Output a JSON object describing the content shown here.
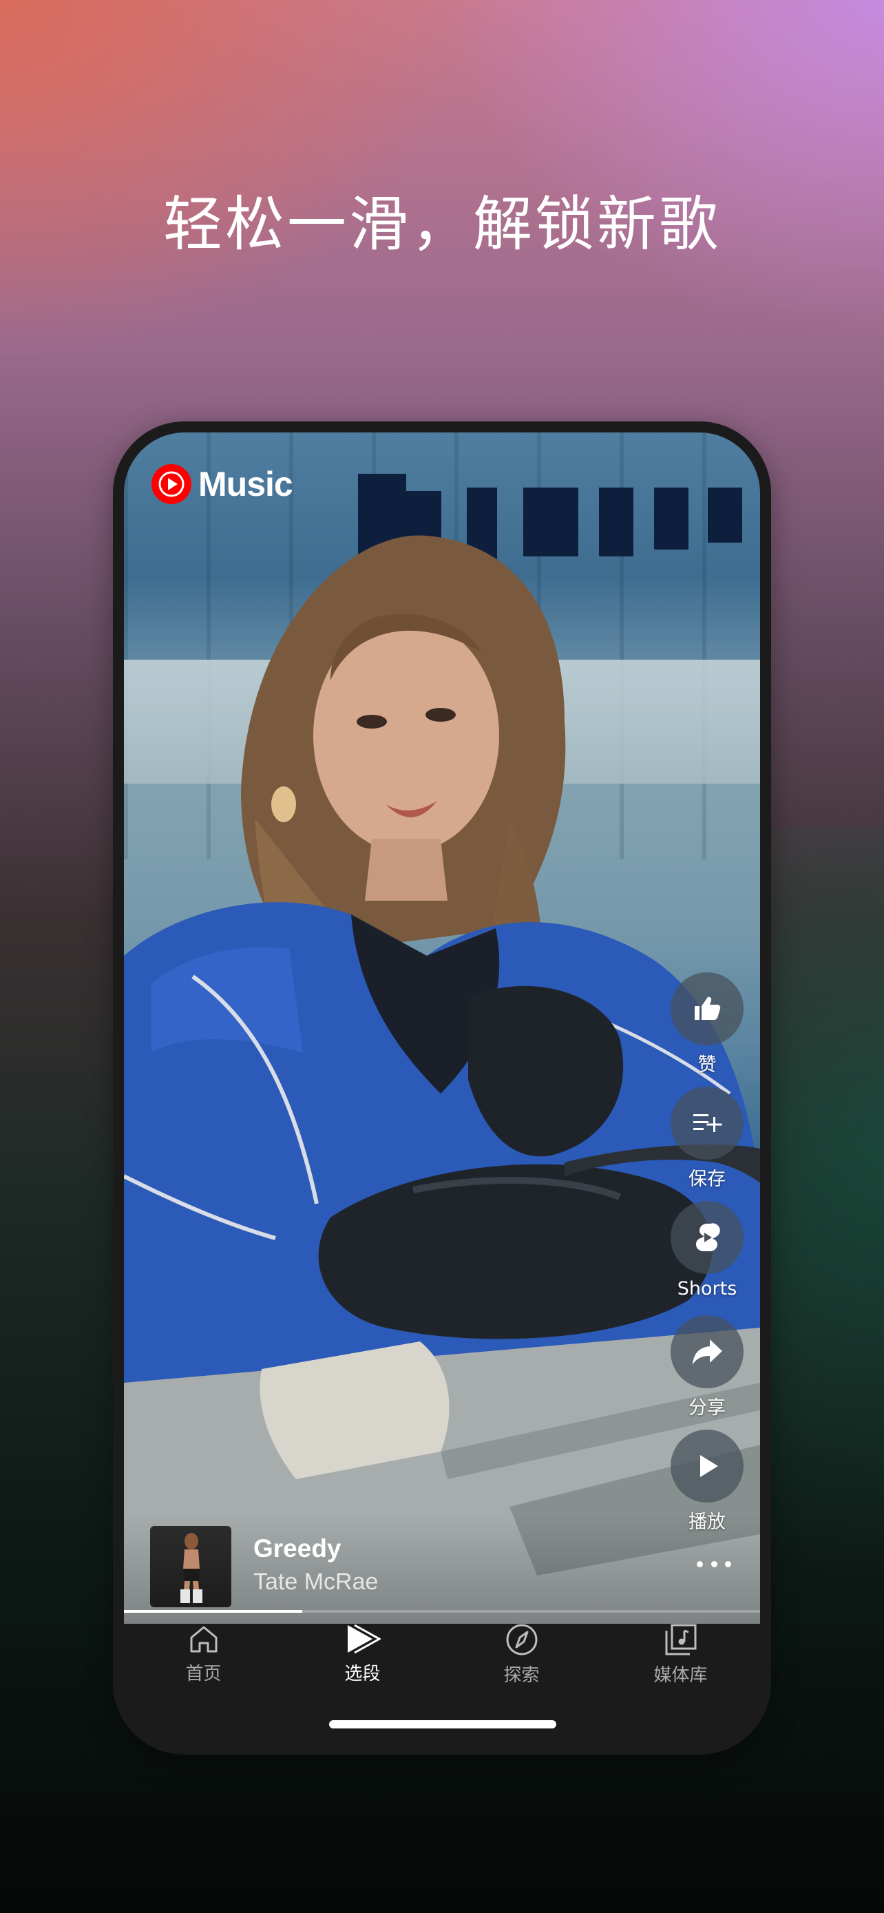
{
  "headline": "轻松一滑，解锁新歌",
  "app": {
    "logo_text": "Music",
    "logo_icon": "youtube-music-icon",
    "brand_color": "#ff0000"
  },
  "actions": [
    {
      "icon": "thumbs-up-icon",
      "label": "赞"
    },
    {
      "icon": "playlist-add-icon",
      "label": "保存"
    },
    {
      "icon": "shorts-icon",
      "label": "Shorts"
    },
    {
      "icon": "share-icon",
      "label": "分享"
    },
    {
      "icon": "play-icon",
      "label": "播放"
    }
  ],
  "now_playing": {
    "title": "Greedy",
    "artist": "Tate McRae",
    "progress": 0.28,
    "more_icon": "more-horizontal-icon"
  },
  "nav": [
    {
      "icon": "home-icon",
      "label": "首页",
      "active": false
    },
    {
      "icon": "samples-icon",
      "label": "选段",
      "active": true
    },
    {
      "icon": "explore-compass-icon",
      "label": "探索",
      "active": false
    },
    {
      "icon": "library-icon",
      "label": "媒体库",
      "active": false
    }
  ]
}
